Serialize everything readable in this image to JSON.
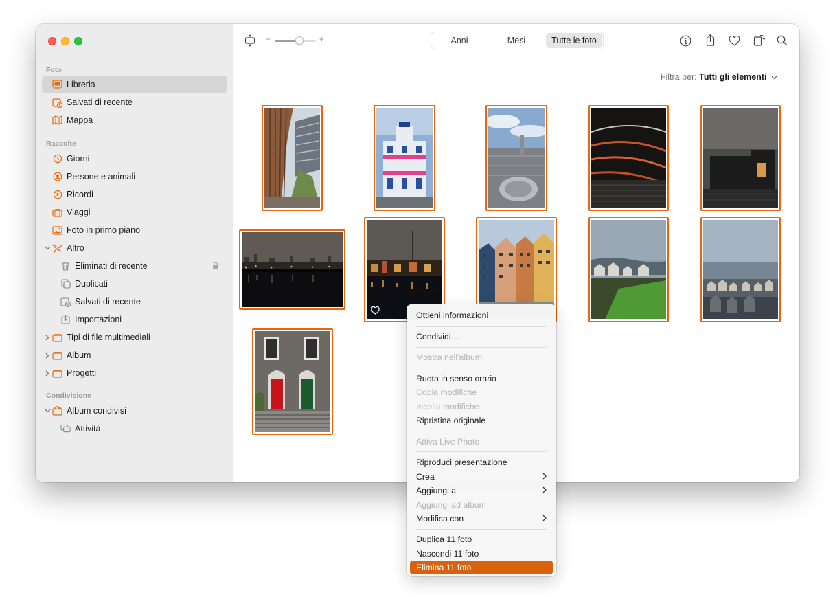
{
  "colors": {
    "accent": "#e8670e",
    "menu_highlight": "#d9620d",
    "sidebar_bg": "#ececec"
  },
  "sidebar": {
    "sections": [
      {
        "title": "Foto"
      },
      {
        "title": "Raccolte"
      },
      {
        "title": "Condivisione"
      }
    ],
    "items": [
      {
        "label": "Libreria",
        "icon": "library-icon"
      },
      {
        "label": "Salvati di recente",
        "icon": "recently-saved-icon"
      },
      {
        "label": "Mappa",
        "icon": "map-icon"
      },
      {
        "label": "Giorni",
        "icon": "days-icon"
      },
      {
        "label": "Persone e animali",
        "icon": "people-icon"
      },
      {
        "label": "Ricordi",
        "icon": "memories-icon"
      },
      {
        "label": "Viaggi",
        "icon": "trips-icon"
      },
      {
        "label": "Foto in primo piano",
        "icon": "featured-photos-icon"
      },
      {
        "label": "Altro",
        "icon": "other-icon"
      },
      {
        "label": "Eliminati di recente",
        "icon": "trash-icon"
      },
      {
        "label": "Duplicati",
        "icon": "duplicates-icon"
      },
      {
        "label": "Salvati di recente",
        "icon": "recently-saved-icon"
      },
      {
        "label": "Importazioni",
        "icon": "imports-icon"
      },
      {
        "label": "Tipi di file multimediali",
        "icon": "folder-icon"
      },
      {
        "label": "Album",
        "icon": "folder-icon"
      },
      {
        "label": "Progetti",
        "icon": "folder-icon"
      },
      {
        "label": "Album condivisi",
        "icon": "shared-albums-icon"
      },
      {
        "label": "Attività",
        "icon": "activity-icon"
      }
    ]
  },
  "toolbar": {
    "zoom_minus": "−",
    "zoom_plus": "+",
    "zoom_level": 0.6,
    "tabs": [
      {
        "label": "Anni"
      },
      {
        "label": "Mesi"
      },
      {
        "label": "Tutte le foto"
      }
    ]
  },
  "filter": {
    "label": "Filtra per:",
    "value": "Tutti gli elementi"
  },
  "context_menu": {
    "items": [
      {
        "label": "Ottieni informazioni"
      },
      {
        "label": "Condividi…"
      },
      {
        "label": "Mostra nell'album"
      },
      {
        "label": "Ruota in senso orario"
      },
      {
        "label": "Copia modifiche"
      },
      {
        "label": "Incolla modifiche"
      },
      {
        "label": "Ripristina originale"
      },
      {
        "label": "Attiva Live Photo"
      },
      {
        "label": "Riproduci presentazione"
      },
      {
        "label": "Crea"
      },
      {
        "label": "Aggiungi a"
      },
      {
        "label": "Aggiungi ad album"
      },
      {
        "label": "Modifica con"
      },
      {
        "label": "Duplica 11 foto"
      },
      {
        "label": "Nascondi 11 foto"
      },
      {
        "label": "Elimina 11 foto"
      }
    ]
  }
}
